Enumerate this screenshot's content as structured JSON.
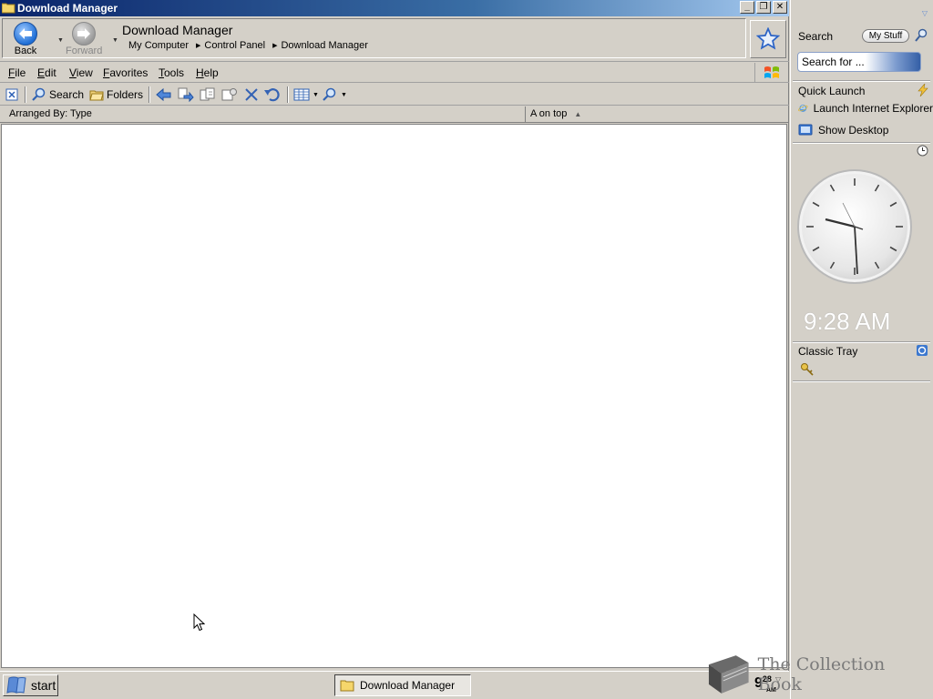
{
  "window": {
    "title": "Download Manager",
    "controls": {
      "minimize": "_",
      "restore": "❐",
      "close": "✕"
    }
  },
  "nav": {
    "back_label": "Back",
    "forward_label": "Forward",
    "page_heading": "Download Manager",
    "breadcrumbs": [
      "My Computer",
      "Control Panel",
      "Download Manager"
    ]
  },
  "menu": {
    "items": [
      {
        "key": "F",
        "rest": "ile"
      },
      {
        "key": "E",
        "rest": "dit"
      },
      {
        "key": "V",
        "rest": "iew"
      },
      {
        "key": "F",
        "rest": "avorites"
      },
      {
        "key": "T",
        "rest": "ools"
      },
      {
        "key": "H",
        "rest": "elp"
      }
    ]
  },
  "toolbar": {
    "search_label": "Search",
    "folders_label": "Folders"
  },
  "columns": {
    "arranged_by": "Arranged By: Type",
    "sort": "A on top"
  },
  "sidebar": {
    "search_title": "Search",
    "my_stuff": "My Stuff",
    "search_placeholder": "Search for ...",
    "quick_launch_title": "Quick Launch",
    "quick_launch_items": [
      "Launch Internet Explorer",
      "Show Desktop"
    ],
    "clock_time": "9:28 AM",
    "classic_tray_title": "Classic Tray"
  },
  "taskbar": {
    "start_label": "start",
    "task_button": "Download Manager",
    "clock_hour": "9",
    "clock_min": "28",
    "clock_ampm": "AM"
  },
  "watermark": {
    "text": "The Collection Book"
  },
  "colors": {
    "title_start": "#0a246a",
    "title_end": "#a6caf0",
    "face": "#d4d0c8"
  }
}
